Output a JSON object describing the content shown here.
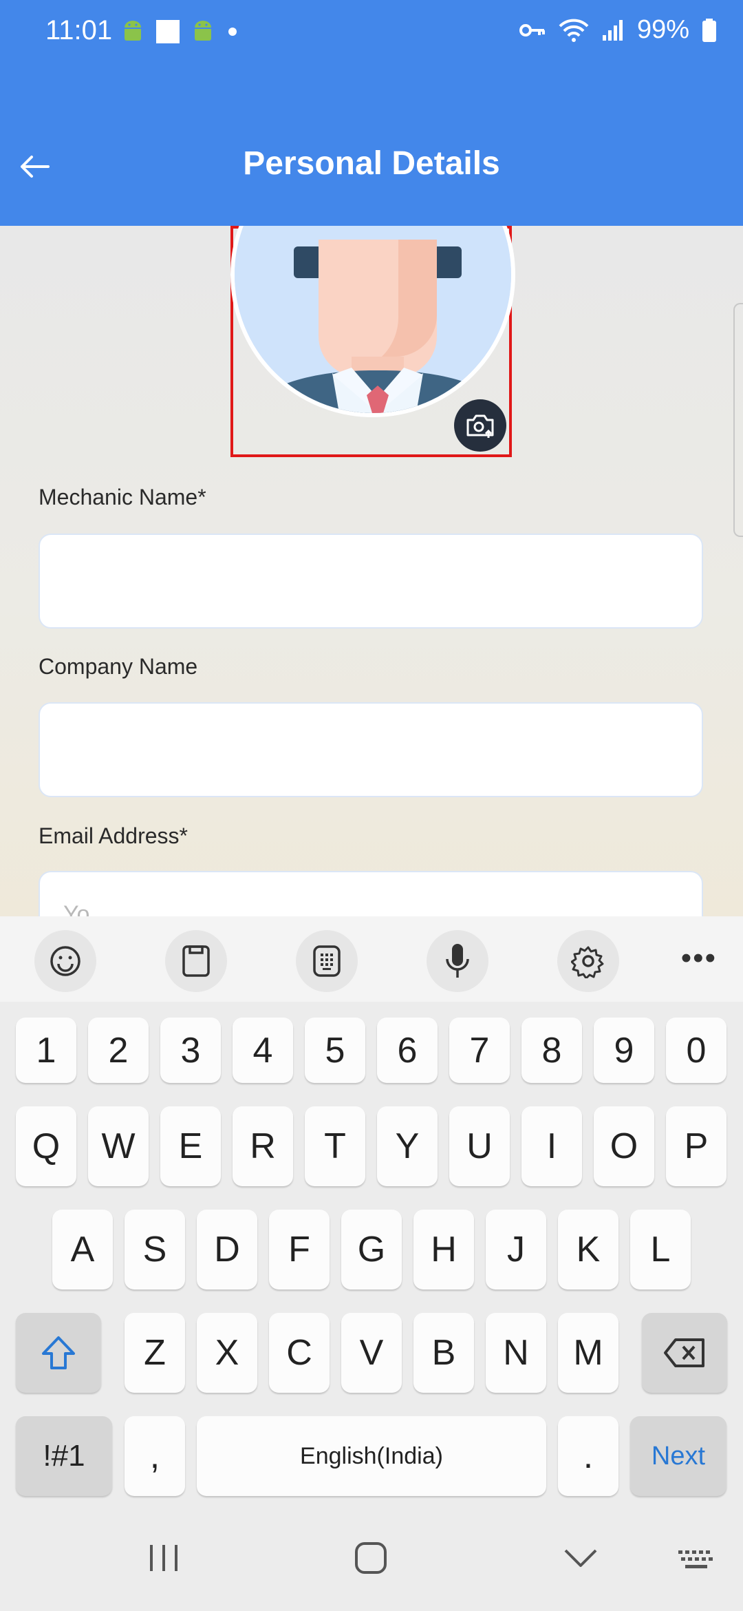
{
  "status_bar": {
    "time": "11:01",
    "battery": "99%"
  },
  "toolbar": {
    "title": "Personal Details"
  },
  "form": {
    "mechanic_name_label": "Mechanic Name*",
    "mechanic_name_value": "",
    "company_name_label": "Company Name",
    "company_name_value": "",
    "email_label": "Email Address*",
    "email_placeholder": "Yo"
  },
  "keyboard": {
    "numbers": [
      "1",
      "2",
      "3",
      "4",
      "5",
      "6",
      "7",
      "8",
      "9",
      "0"
    ],
    "row1": [
      "Q",
      "W",
      "E",
      "R",
      "T",
      "Y",
      "U",
      "I",
      "O",
      "P"
    ],
    "row2": [
      "A",
      "S",
      "D",
      "F",
      "G",
      "H",
      "J",
      "K",
      "L"
    ],
    "row3": [
      "Z",
      "X",
      "C",
      "V",
      "B",
      "N",
      "M"
    ],
    "symbols_label": "!#1",
    "comma": ",",
    "space_label": "English(India)",
    "period": ".",
    "next_label": "Next"
  },
  "colors": {
    "app_bar": "#4387ea",
    "accent_next": "#2878d4",
    "highlight_box": "#e01818"
  }
}
